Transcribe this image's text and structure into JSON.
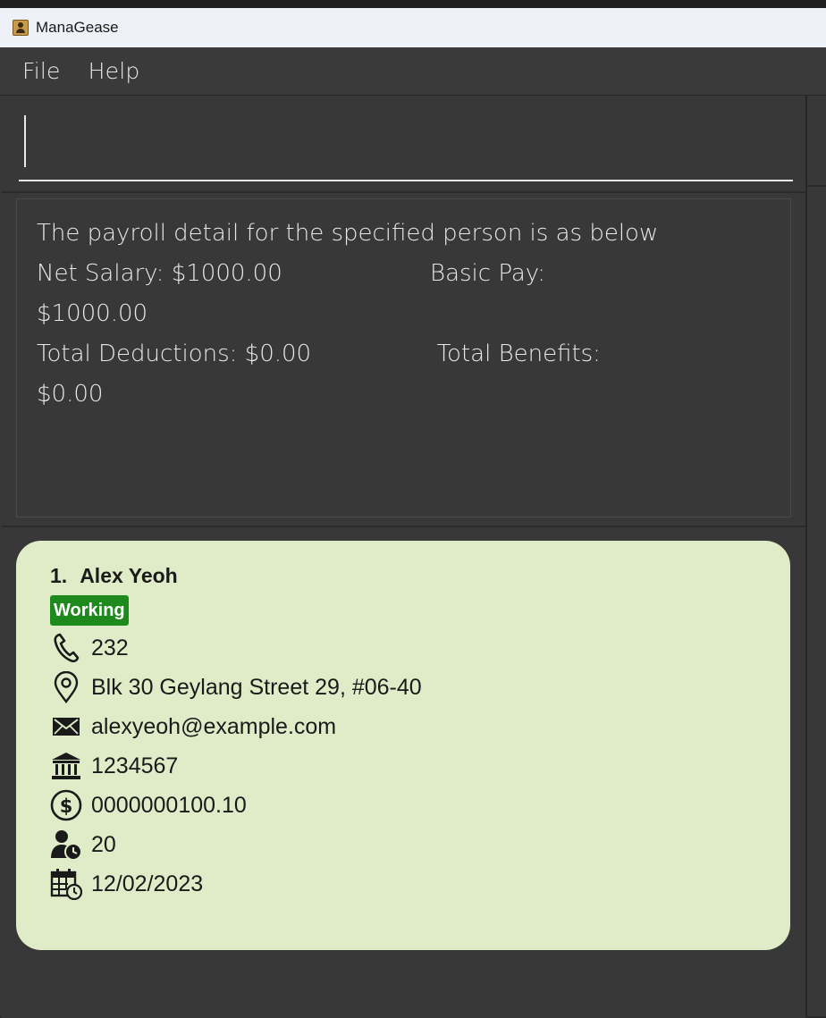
{
  "window": {
    "title": "ManaGease"
  },
  "menu": {
    "file": "File",
    "help": "Help"
  },
  "command": {
    "value": ""
  },
  "result": {
    "lines": [
      "The payroll detail for the specified person is as below",
      "Net Salary: $1000.00                    Basic Pay:",
      "$1000.00",
      "Total Deductions: $0.00                 Total Benefits:",
      "$0.00"
    ]
  },
  "person": {
    "index": "1.",
    "name": "Alex Yeoh",
    "status": "Working",
    "phone": "232",
    "address": "Blk 30 Geylang Street 29, #06-40",
    "email": "alexyeoh@example.com",
    "bank_account": "1234567",
    "salary": "0000000100.10",
    "annual_leave": "20",
    "join_date": "12/02/2023"
  },
  "colors": {
    "card_background": "#e0ecc8",
    "status_working": "#1e8a1e",
    "panel_background": "#383838"
  },
  "icons": [
    "app-icon",
    "phone-icon",
    "location-pin-icon",
    "envelope-icon",
    "bank-icon",
    "dollar-circle-icon",
    "person-clock-icon",
    "calendar-clock-icon"
  ]
}
